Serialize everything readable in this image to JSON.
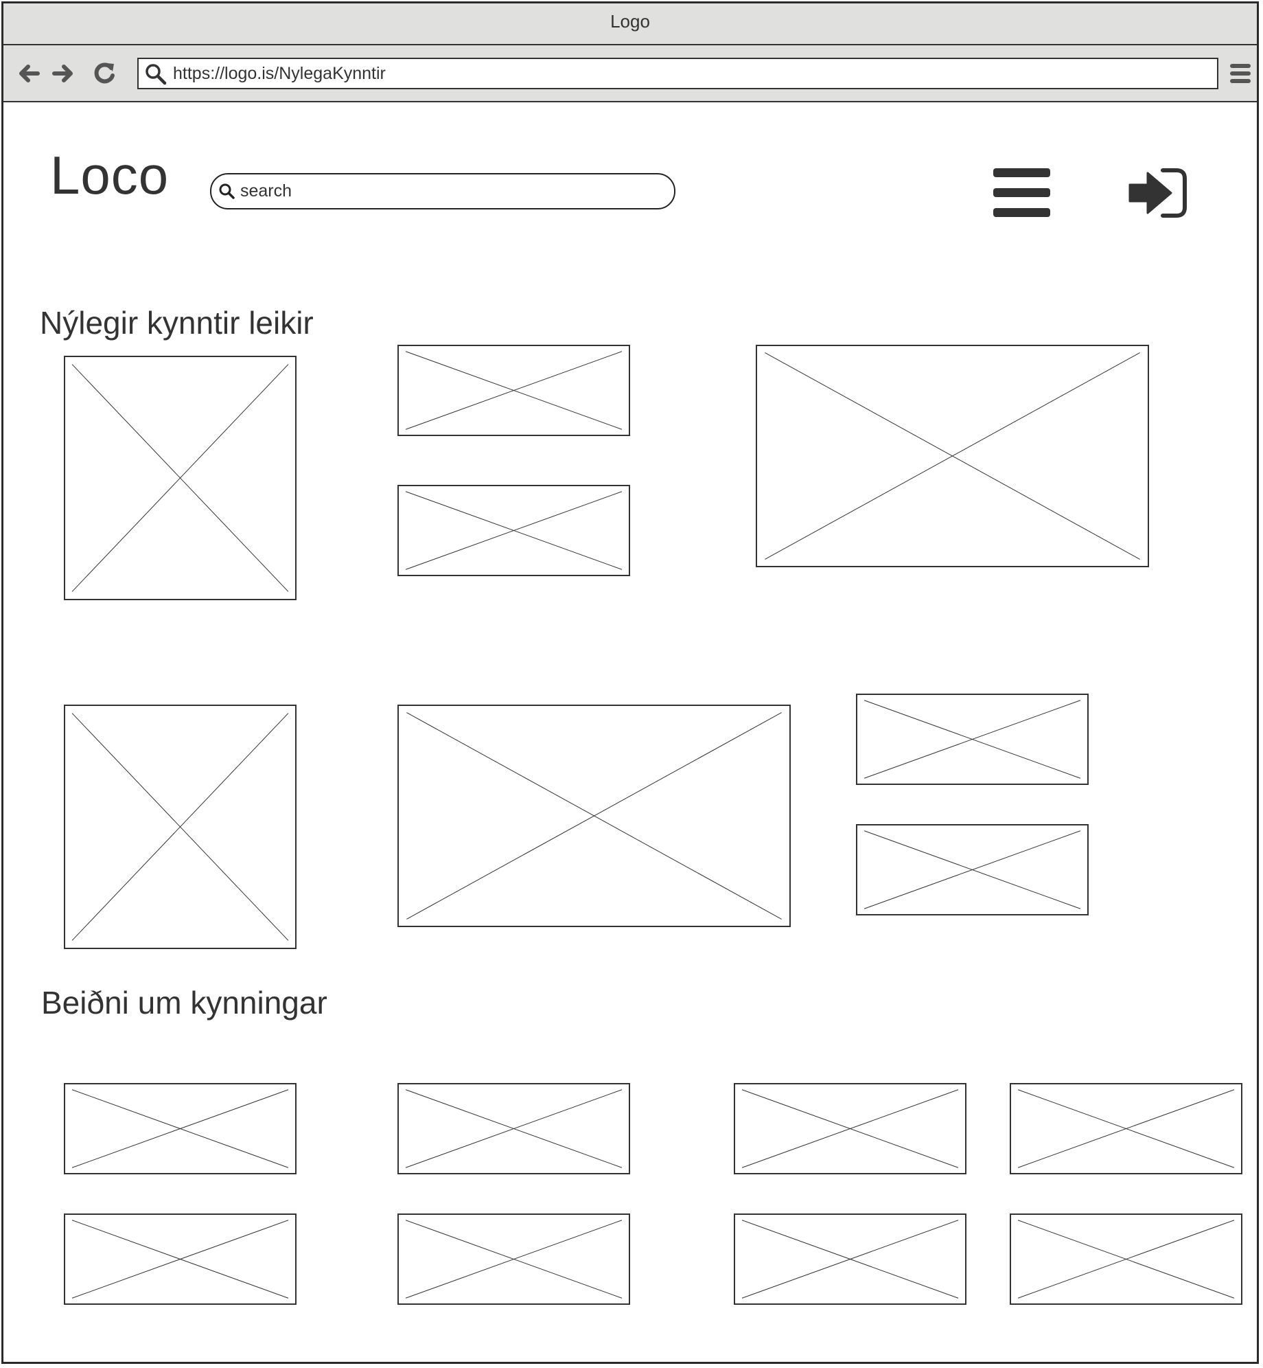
{
  "window": {
    "title": "Logo"
  },
  "browser": {
    "url": "https://logo.is/NylegaKynntir",
    "back_icon": "arrow-left-icon",
    "forward_icon": "arrow-right-icon",
    "reload_icon": "reload-icon",
    "menu_icon": "menu-icon"
  },
  "header": {
    "logo": "Loco",
    "search": {
      "placeholder": "search",
      "value": ""
    },
    "menu_icon": "hamburger-icon",
    "login_icon": "sign-in-icon"
  },
  "sections": {
    "recent": {
      "title": "Nýlegir kynntir leikir"
    },
    "requests": {
      "title": "Beiðni um kynningar"
    }
  },
  "colors": {
    "chrome": "#e0e0df",
    "ink": "#333333",
    "background": "#ffffff"
  }
}
